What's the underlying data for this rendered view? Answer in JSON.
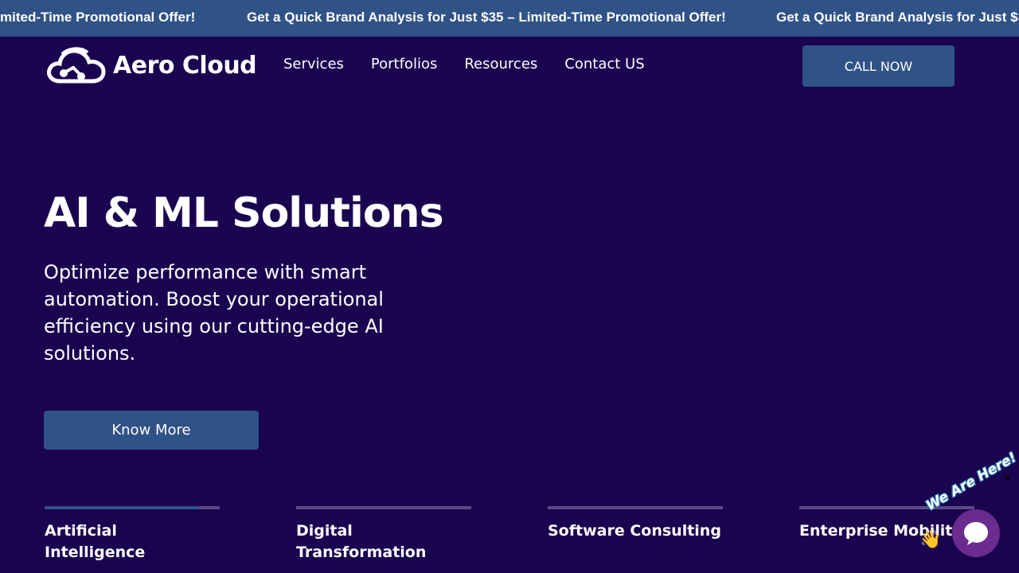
{
  "ticker": {
    "message_partial": "mited-Time Promotional Offer!",
    "message_full": "Get a Quick Brand Analysis for Just $35 – Limited-Time Promotional Offer!",
    "message_trailing": "Get a Quick Brand Analysis for Just $3"
  },
  "header": {
    "logo_text": "Aero Cloud",
    "nav": [
      "Services",
      "Portfolios",
      "Resources",
      "Contact US"
    ],
    "call_label": "CALL NOW"
  },
  "hero": {
    "title": "AI & ML Solutions",
    "subtitle": "Optimize performance with smart automation. Boost your operational efficiency using our cutting-edge AI solutions.",
    "cta_label": "Know More"
  },
  "tabs": [
    {
      "label": "Artificial Intelligence",
      "progress": 0.88
    },
    {
      "label": "Digital Transformation",
      "progress": 0
    },
    {
      "label": "Software Consulting",
      "progress": 0
    },
    {
      "label": "Enterprise Mobility",
      "progress": 0
    }
  ],
  "chat": {
    "badge_text": "We Are Here!",
    "icon": "chat-bubble-icon",
    "close_icon": "close-icon"
  },
  "colors": {
    "background": "#1a0450",
    "accent": "#2f5287",
    "chat": "#6a2c8f"
  }
}
